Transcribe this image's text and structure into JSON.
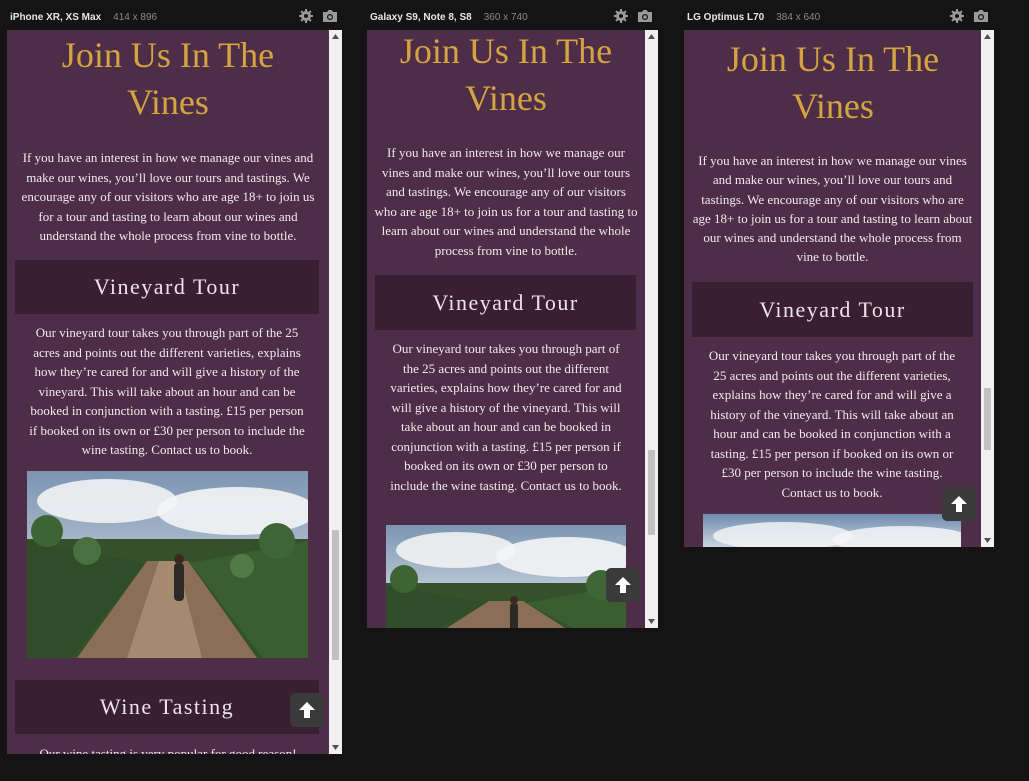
{
  "devices": [
    {
      "name": "iPhone XR, XS Max",
      "size": "414 x 896",
      "content": {
        "hero_title": "Join Us In The Vines",
        "intro": "If you have an interest in how we manage our vines and make our wines, you’ll love our tours and tastings. We encourage any of our visitors who are age 18+ to join us for a tour and tasting to learn about our wines and understand the whole process from vine to bottle.",
        "tour_heading": "Vineyard Tour",
        "tour_text": "Our vineyard tour takes you through part of the 25 acres and points out the different varieties, explains how they’re cared for and will give a history of the vineyard. This will take about an hour and can be booked in conjunction with a tasting. £15 per person if booked on its own or £30 per person to include the wine tasting. Contact us to book.",
        "tasting_heading": "Wine Tasting",
        "tasting_text": "Our wine tasting is very popular for good reason!"
      }
    },
    {
      "name": "Galaxy S9, Note 8, S8",
      "size": "360 x 740",
      "content": {
        "hero_title": "Join Us In The Vines",
        "intro": "If you have an interest in how we manage our vines and make our wines, you’ll love our tours and tastings. We encourage any of our visitors who are age 18+ to join us for a tour and tasting to learn about our wines and understand the whole process from vine to bottle.",
        "tour_heading": "Vineyard Tour",
        "tour_text": "Our vineyard tour takes you through part of the 25 acres and points out the different varieties, explains how they’re cared for and will give a history of the vineyard. This will take about an hour and can be booked in conjunction with a tasting. £15 per person if booked on its own or £30 per person to include the wine tasting. Contact us to book."
      }
    },
    {
      "name": "LG Optimus L70",
      "size": "384 x 640",
      "content": {
        "hero_title": "Join Us In The Vines",
        "intro": "If you have an interest in how we manage our vines and make our wines, you’ll love our tours and tastings. We encourage any of our visitors who are age 18+ to join us for a tour and tasting to learn about our wines and understand the whole process from vine to bottle.",
        "tour_heading": "Vineyard Tour",
        "tour_text": "Our vineyard tour takes you through part of the 25 acres and points out the different varieties, explains how they’re cared for and will give a history of the vineyard. This will take about an hour and can be booked in conjunction with a tasting. £15 per person if booked on its own or £30 per person to include the wine tasting. Contact us to book."
      }
    }
  ],
  "icons": {
    "settings": "gear-icon",
    "screenshot": "camera-icon",
    "back_to_top": "arrow-up-icon",
    "scroll_up": "scroll-up-arrow-icon",
    "scroll_down": "scroll-down-arrow-icon"
  },
  "colors": {
    "background": "#141414",
    "page": "#4e2d48",
    "section_header": "#3a1f33",
    "title_gold": "#d4a440",
    "text": "#f1ebef"
  }
}
